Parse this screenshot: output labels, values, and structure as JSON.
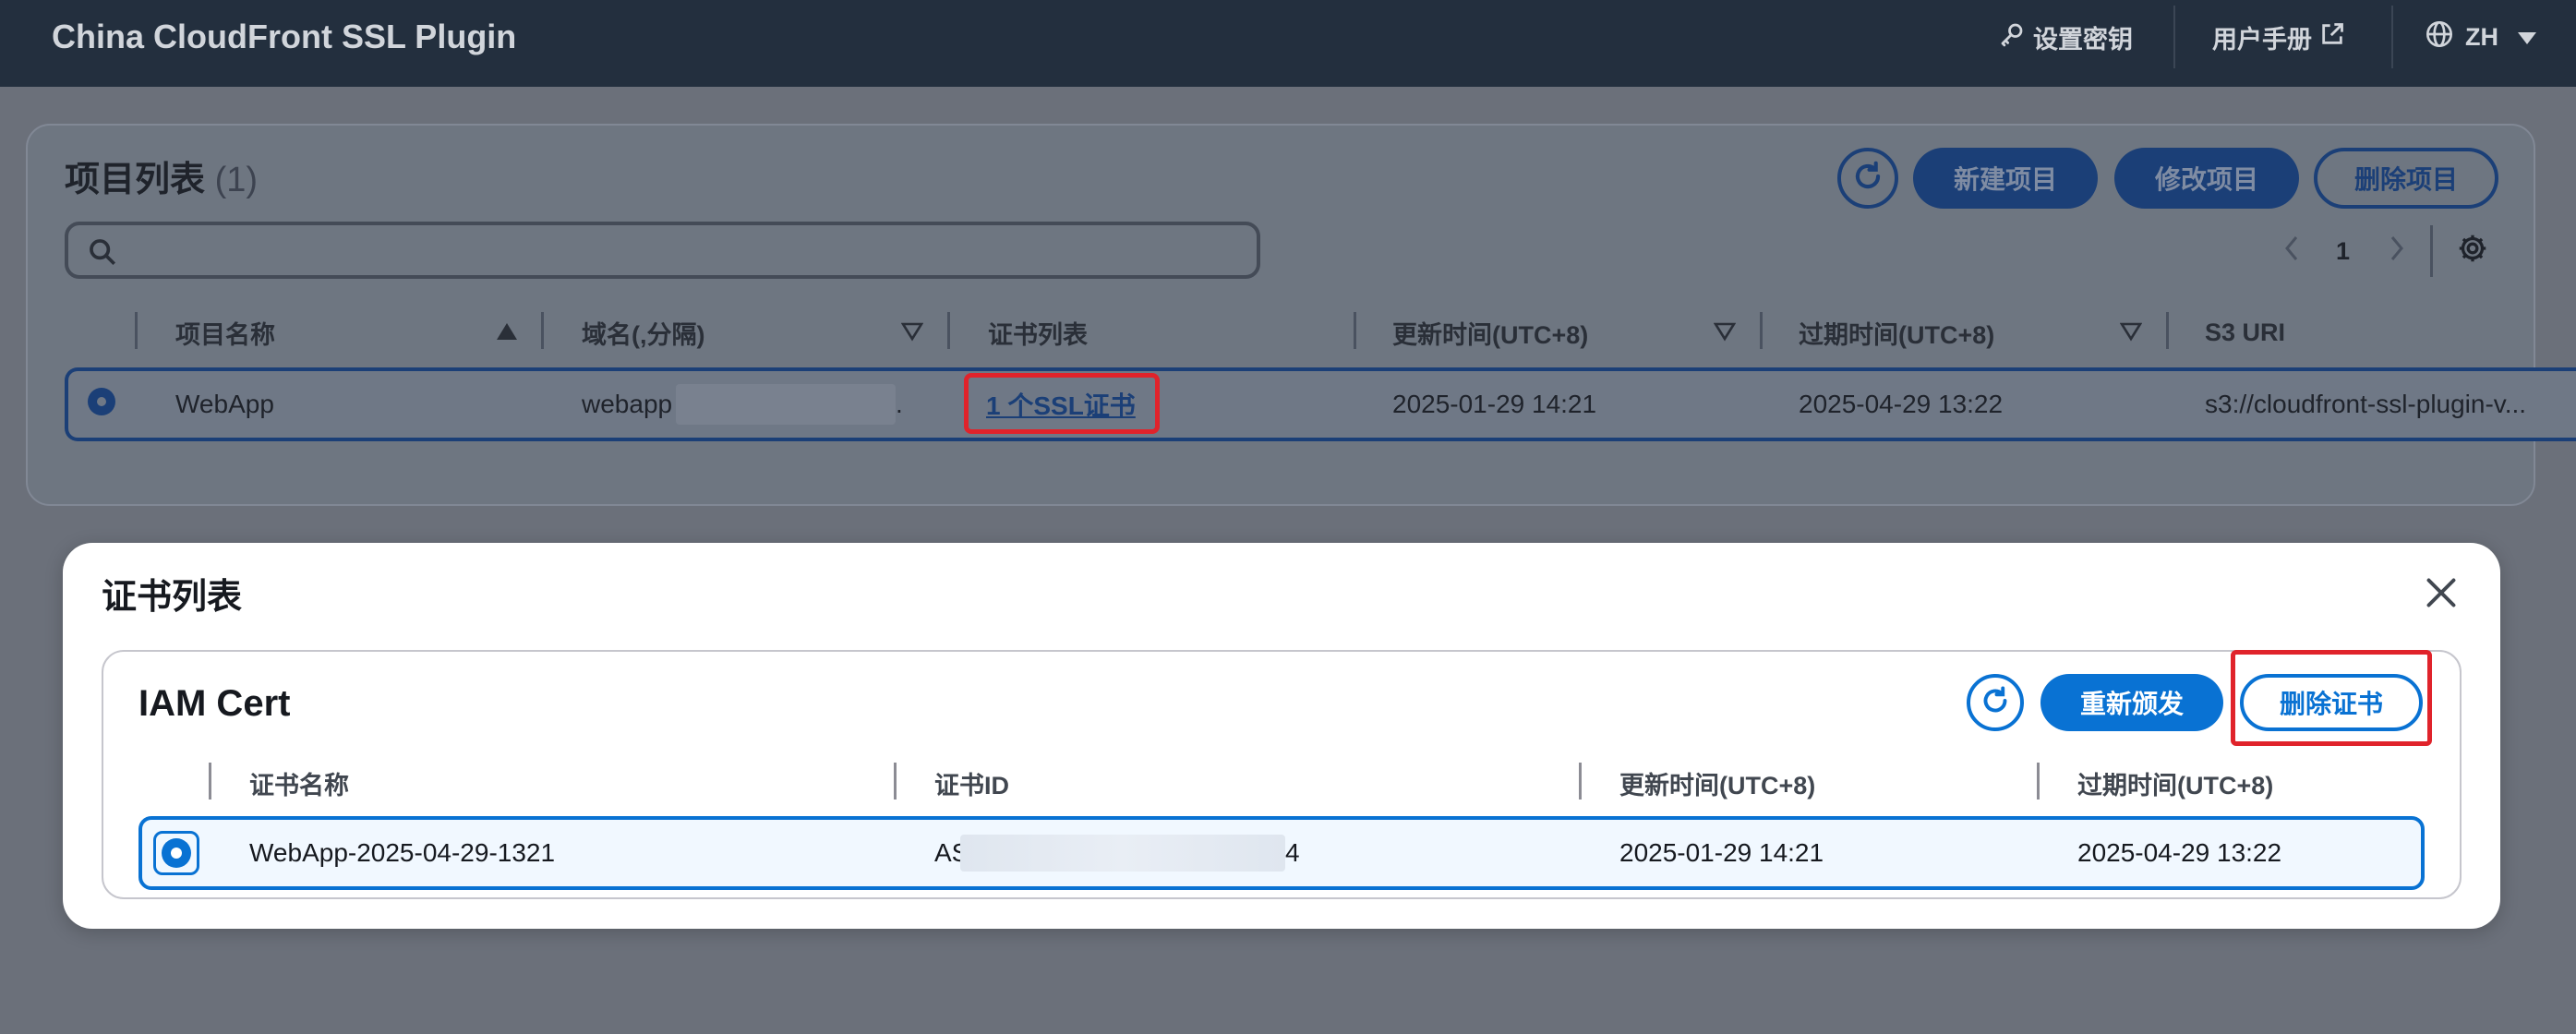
{
  "app": {
    "title": "China CloudFront SSL Plugin",
    "nav": {
      "settings_key": "设置密钥",
      "user_manual": "用户手册",
      "language": "ZH"
    }
  },
  "projects": {
    "title": "项目列表",
    "count": "(1)",
    "buttons": {
      "new": "新建项目",
      "edit": "修改项目",
      "delete": "删除项目"
    },
    "search": {
      "placeholder": ""
    },
    "pagination": {
      "current_page": "1"
    },
    "columns": [
      "项目名称",
      "域名(,分隔)",
      "证书列表",
      "更新时间(UTC+8)",
      "过期时间(UTC+8)",
      "S3 URI"
    ],
    "rows": [
      {
        "name": "WebApp",
        "domain_prefix": "webapp",
        "domain_suffix": ".",
        "cert_link": "1 个SSL证书",
        "updated": "2025-01-29 14:21",
        "expires": "2025-04-29 13:22",
        "s3_uri": "s3://cloudfront-ssl-plugin-v..."
      }
    ]
  },
  "modal": {
    "title": "证书列表",
    "card_title": "IAM Cert",
    "buttons": {
      "reissue": "重新颁发",
      "delete": "删除证书"
    },
    "columns": [
      "证书名称",
      "证书ID",
      "更新时间(UTC+8)",
      "过期时间(UTC+8)"
    ],
    "rows": [
      {
        "name": "WebApp-2025-04-29-1321",
        "id_prefix": "AS",
        "id_suffix": "4",
        "updated": "2025-01-29 14:21",
        "expires": "2025-04-29 13:22"
      }
    ]
  },
  "colors": {
    "nav_bg": "#232f3e",
    "primary": "#0972d3",
    "highlight_red": "#e0232b",
    "overlay": "#6b707a"
  },
  "icons": [
    "key-icon",
    "external-link-icon",
    "globe-icon",
    "caret-down-icon",
    "refresh-icon",
    "search-icon",
    "chevron-left-icon",
    "chevron-right-icon",
    "gear-icon",
    "sort-up-icon",
    "sort-down-icon",
    "close-icon"
  ]
}
